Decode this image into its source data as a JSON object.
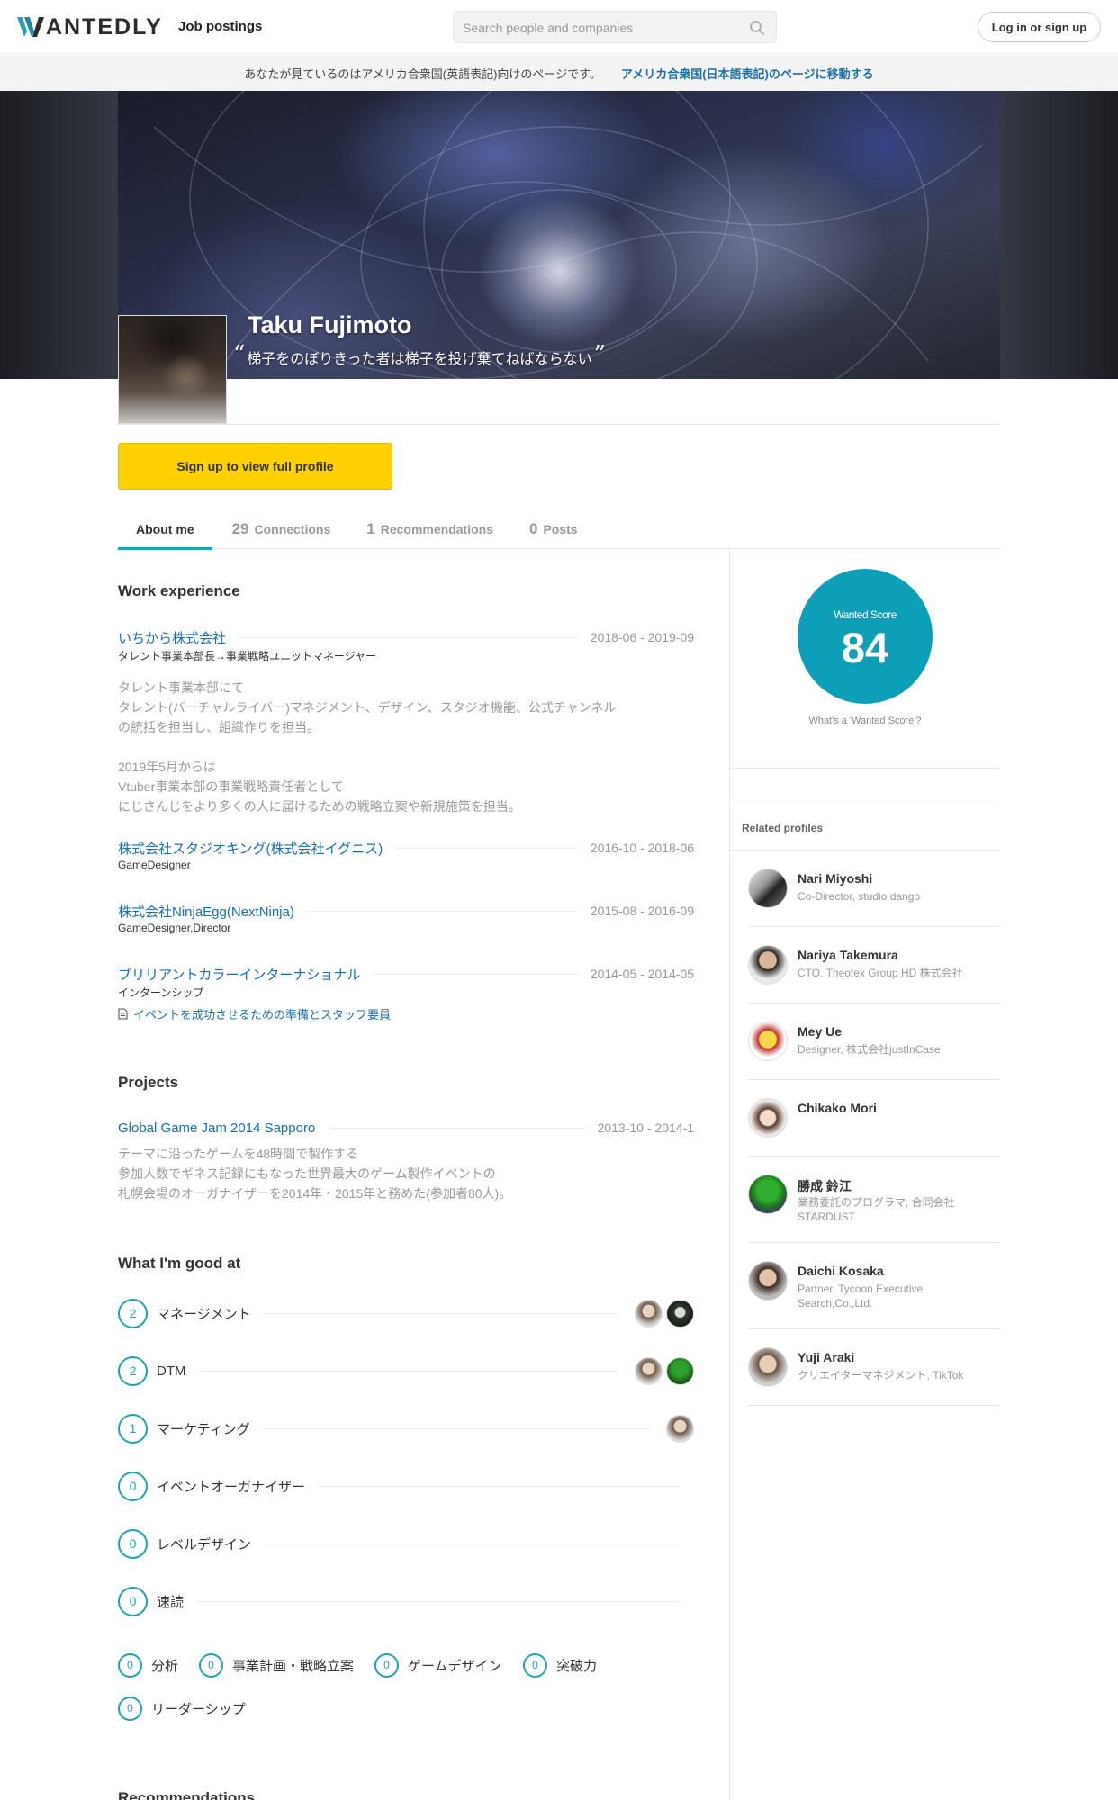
{
  "header": {
    "logo_text": "ANTEDLY",
    "nav_job_postings": "Job postings",
    "search_placeholder": "Search people and companies",
    "login_label": "Log in or sign up"
  },
  "locale_banner": {
    "text": "あなたが見ているのはアメリカ合衆国(英語表記)向けのページです。",
    "link": "アメリカ合衆国(日本語表記)のページに移動する"
  },
  "profile": {
    "name": "Taku Fujimoto",
    "quote": "梯子をのぼりきった者は梯子を投げ棄てねばならない",
    "signup_label": "Sign up to view full profile"
  },
  "tabs": [
    {
      "count": "",
      "label": "About me"
    },
    {
      "count": "29",
      "label": "Connections"
    },
    {
      "count": "1",
      "label": "Recommendations"
    },
    {
      "count": "0",
      "label": "Posts"
    }
  ],
  "work_experience": {
    "title": "Work experience",
    "items": [
      {
        "company": "いちから株式会社",
        "date": "2018-06 - 2019-09",
        "role": "タレント事業本部長→事業戦略ユニットマネージャー",
        "description": "タレント事業本部にて\nタレント(バーチャルライバー)マネジメント、デザイン、スタジオ機能、公式チャンネル\nの統括を担当し、組織作りを担当。\n\n2019年5月からは\nVtuber事業本部の事業戦略責任者として\nにじさんじをより多くの人に届けるための戦略立案や新規施策を担当。"
      },
      {
        "company": "株式会社スタジオキング(株式会社イグニス)",
        "date": "2016-10 - 2018-06",
        "role": "GameDesigner"
      },
      {
        "company": "株式会社NinjaEgg(NextNinja)",
        "date": "2015-08 - 2016-09",
        "role": "GameDesigner,Director"
      },
      {
        "company": "ブリリアントカラーインターナショナル",
        "date": "2014-05 - 2014-05",
        "role": "インターンシップ",
        "link": "イベントを成功させるための準備とスタッフ要員"
      }
    ]
  },
  "projects": {
    "title": "Projects",
    "items": [
      {
        "name": "Global Game Jam 2014 Sapporo",
        "date": "2013-10 - 2014-1",
        "description": "テーマに沿ったゲームを48時間で製作する\n参加人数でギネス記録にもなった世界最大のゲーム製作イベントの\n札幌会場のオーガナイザーを2014年・2015年と務めた(参加者80人)。"
      }
    ]
  },
  "skills": {
    "title": "What I'm good at",
    "rows": [
      {
        "count": "2",
        "name": "マネージメント"
      },
      {
        "count": "2",
        "name": "DTM"
      },
      {
        "count": "1",
        "name": "マーケティング"
      },
      {
        "count": "0",
        "name": "イベントオーガナイザー"
      },
      {
        "count": "0",
        "name": "レベルデザイン"
      },
      {
        "count": "0",
        "name": "速読"
      }
    ],
    "chips": [
      {
        "count": "0",
        "name": "分析"
      },
      {
        "count": "0",
        "name": "事業計画・戦略立案"
      },
      {
        "count": "0",
        "name": "ゲームデザイン"
      },
      {
        "count": "0",
        "name": "突破力"
      },
      {
        "count": "0",
        "name": "リーダーシップ"
      }
    ]
  },
  "recommendations_heading": "Recommendations",
  "sidebar": {
    "score_label": "Wanted Score",
    "score_value": "84",
    "score_help": "What's a 'Wanted Score'?",
    "related_title": "Related profiles",
    "related": [
      {
        "name": "Nari Miyoshi",
        "sub": "Co-Director, studio dango"
      },
      {
        "name": "Nariya Takemura",
        "sub": "CTO, Theotex Group HD 株式会社"
      },
      {
        "name": "Mey Ue",
        "sub": "Designer, 株式会社justInCase"
      },
      {
        "name": "Chikako Mori",
        "sub": ""
      },
      {
        "name": "勝成 鈴江",
        "sub": "業務委託のプログラマ, 合同会社STARDUST"
      },
      {
        "name": "Daichi Kosaka",
        "sub": "Partner, Tycoon Executive Search,Co.,Ltd."
      },
      {
        "name": "Yuji Araki",
        "sub": "クリエイターマネジメント, TikTok"
      }
    ]
  },
  "colors": {
    "accent": "#21a2b9",
    "score_bg": "#0e9fb8",
    "signup_bg": "#ffd100",
    "link": "#1b6fa8"
  }
}
